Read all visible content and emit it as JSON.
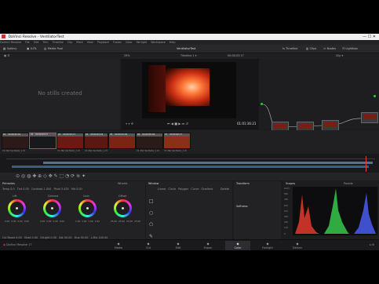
{
  "window_title": "DaVinci Resolve - VentilatorTest",
  "menu": [
    "DaVinci Resolve",
    "File",
    "Edit",
    "Trim",
    "Timeline",
    "Clip",
    "Mark",
    "View",
    "Playback",
    "Fusion",
    "Color",
    "Fairlight",
    "Workspace",
    "Help"
  ],
  "toolbar": {
    "gallery": "Gallery",
    "luts": "LUTs",
    "media_pool": "Media Pool",
    "project": "VentilatorTest",
    "timeline_label": "Timeline",
    "clips": "Clips",
    "nodes": "Nodes",
    "lightbox": "Lightbox"
  },
  "sub": {
    "zoom": "29%",
    "timeline_name": "Timeline 1",
    "timecode": "00:00:03:17",
    "clip": "Clip"
  },
  "gallery": {
    "empty_text": "No stills created"
  },
  "viewer": {
    "timecode": "01:01:36:21"
  },
  "clips": [
    {
      "num": "01",
      "tc": "00:00:02:16",
      "name": "V1 264 Ventilator_1 M"
    },
    {
      "num": "02",
      "tc": "00:00:03:17",
      "name": ""
    },
    {
      "num": "03",
      "tc": "00:00:03:17",
      "name": "V1 264 Ventilator_1 M"
    },
    {
      "num": "04",
      "tc": "00:00:03:24",
      "name": "V1 264 Ventilator_1 M"
    },
    {
      "num": "05",
      "tc": "00:00:04:04",
      "name": ""
    },
    {
      "num": "06",
      "tc": "00:00:05:04",
      "name": "V1 264 Ventilator_1 M"
    },
    {
      "num": "07",
      "tc": "00:00:00:17",
      "name": "V1 264 Ventilator_1 M"
    }
  ],
  "primaries": {
    "title": "Primaries",
    "wheels_label": "Wheels",
    "temp_label": "Temp",
    "temp": "0.0",
    "tint_label": "Tint",
    "tint": "0.00",
    "contrast_label": "Contrast",
    "contrast": "1.000",
    "pivot_label": "Pivot",
    "pivot": "0.435",
    "md_label": "Md",
    "md": "0.00",
    "wheels": [
      {
        "name": "Lift",
        "vals": [
          "0.00",
          "0.00",
          "0.00",
          "0.00"
        ]
      },
      {
        "name": "Gamma",
        "vals": [
          "0.00",
          "0.00",
          "0.00",
          "0.00"
        ]
      },
      {
        "name": "Gain",
        "vals": [
          "1.00",
          "1.00",
          "1.00",
          "1.00"
        ]
      },
      {
        "name": "Offset",
        "vals": [
          "25.00",
          "25.00",
          "25.00",
          "25.00"
        ]
      }
    ],
    "footer": {
      "cb_label": "Col Boost",
      "cb": "0.00",
      "shad_label": "Shad",
      "shad": "0.00",
      "hl_label": "HiLight",
      "hl": "0.00",
      "sat_label": "Sat",
      "sat": "50.00",
      "hue_label": "Hue",
      "hue": "50.00",
      "lmix_label": "L.Mix",
      "lmix": "100.00"
    }
  },
  "window_panel": {
    "title": "Window",
    "buttons": [
      "Linear",
      "Circle",
      "Polygon",
      "Curve",
      "Gradient"
    ],
    "delete": "Delete"
  },
  "transform_panel": {
    "title": "Transform",
    "softness": "Softness"
  },
  "scopes": {
    "title": "Scopes",
    "mode": "Parade",
    "scale": [
      "1023",
      "896",
      "768",
      "640",
      "512",
      "384",
      "256",
      "128",
      "0"
    ]
  },
  "bottom": {
    "app": "DaVinci Resolve 17",
    "tabs": [
      "Media",
      "Cut",
      "Edit",
      "Fusion",
      "Color",
      "Fairlight",
      "Deliver"
    ],
    "active": "Color"
  },
  "colors": {
    "accent": "#e33b2e",
    "panel": "#222225"
  }
}
